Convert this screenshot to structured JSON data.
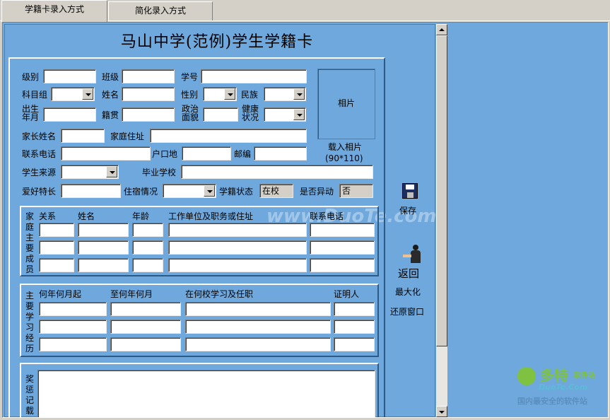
{
  "tabs": [
    {
      "label": "学籍卡录入方式",
      "active": true
    },
    {
      "label": "简化录入方式",
      "active": false
    }
  ],
  "title": "马山中学(范例)学生学籍卡",
  "fields": {
    "grade": "级别",
    "class": "班级",
    "student_no": "学号",
    "subject_group": "科目组",
    "name": "姓名",
    "gender": "性别",
    "ethnicity": "民族",
    "birth": "出生\n年月",
    "native_place": "籍贯",
    "political": "政治\n面貌",
    "health": "健康\n状况",
    "parent_name": "家长姓名",
    "home_address": "家庭住址",
    "phone": "联系电话",
    "hukou": "户口地",
    "postcode": "邮编",
    "source": "学生来源",
    "graduate_school": "毕业学校",
    "hobby": "爱好特长",
    "lodging": "住宿情况",
    "status_label": "学籍状态",
    "status_value": "在校",
    "transfer_label": "是否异动",
    "transfer_value": "否"
  },
  "photo": {
    "label": "相片",
    "load_label": "载入相片",
    "size_hint": "(90*110)"
  },
  "family": {
    "group_label": "家庭主要成员",
    "headers": [
      "关系",
      "姓名",
      "年龄",
      "工作单位及职务或住址",
      "联系电话"
    ]
  },
  "study": {
    "group_label": "主要学习经历",
    "headers": [
      "何年何月起",
      "至何年何月",
      "在何校学习及任职",
      "证明人"
    ]
  },
  "awards": {
    "group_label": "奖惩记载"
  },
  "actions": {
    "save": "保存",
    "back": "返回",
    "maximize": "最大化",
    "restore": "还原窗口"
  },
  "watermark": "www.DuoTe.com",
  "logo": {
    "brand": "多特",
    "brand_sub": "软件站",
    "site": "DuoTe.Com",
    "slogan": "国内最安全的软件站"
  }
}
